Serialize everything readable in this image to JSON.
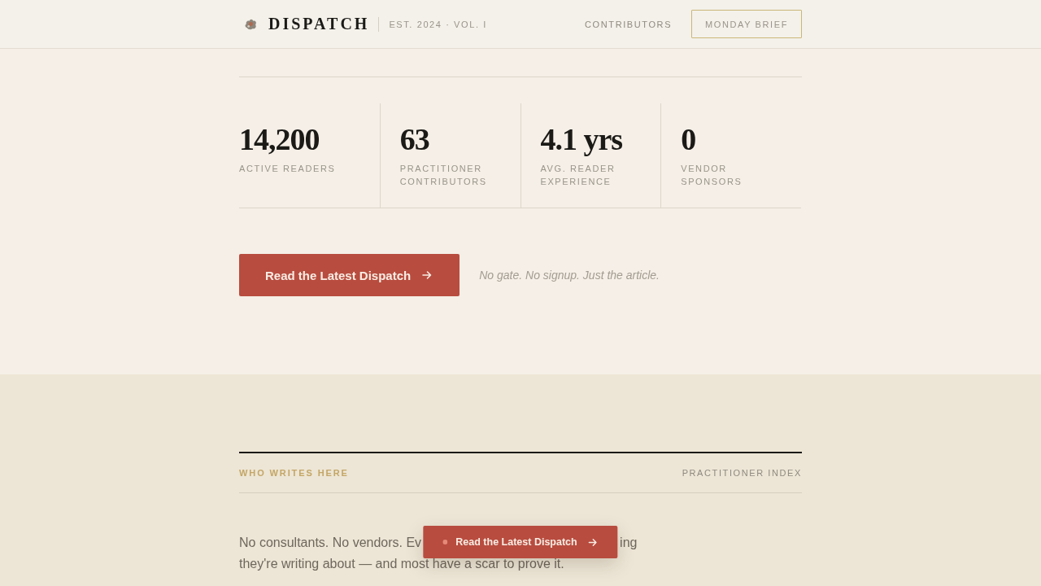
{
  "header": {
    "brand": "DISPATCH",
    "edition": "EST. 2024 · VOL. I",
    "nav": [
      {
        "kind": "link",
        "label": "CONTRIBUTORS"
      },
      {
        "kind": "button",
        "label": "MONDAY BRIEF"
      }
    ]
  },
  "stats": [
    {
      "value": "14,200",
      "label_lines": [
        "ACTIVE READERS"
      ]
    },
    {
      "value": "63",
      "label_lines": [
        "PRACTITIONER",
        "CONTRIBUTORS"
      ]
    },
    {
      "value": "4.1 yrs",
      "label_lines": [
        "AVG. READER",
        "EXPERIENCE"
      ]
    },
    {
      "value": "0",
      "label_lines": [
        "VENDOR",
        "SPONSORS"
      ]
    }
  ],
  "cta": {
    "button": "Read the Latest Dispatch",
    "note": "No gate. No signup. Just the article."
  },
  "section": {
    "eyebrow": "WHO WRITES HERE",
    "link": "PRACTITIONER INDEX",
    "paragraph": {
      "line_1": [
        "No consultants. No vendors. Ev",
        "ing"
      ],
      "line_2": "they're writing about — and most have a scar to prove it."
    }
  },
  "floating_cta": {
    "label": "Read the Latest Dispatch"
  }
}
